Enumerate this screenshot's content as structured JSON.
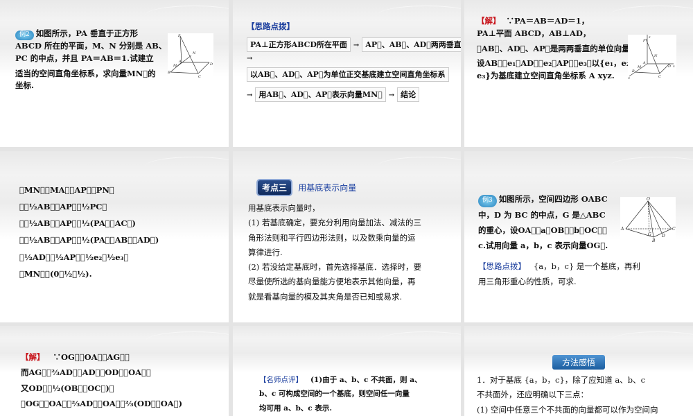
{
  "slides": [
    {
      "badge": "例2",
      "lines": [
        "如图所示，PA 垂直于正方形",
        "ABCD 所在的平面，M、N 分别是 AB、",
        "PC 的中点，并且 PA＝AB＝1.试建立",
        "适当的空间直角坐标系，求向量MN⃗的",
        "坐标."
      ],
      "figure_labels": [
        "P",
        "N",
        "A",
        "M",
        "B",
        "D",
        "C"
      ]
    },
    {
      "heading": "【思路点拨】",
      "box1": "PA⊥正方形ABCD所在平面",
      "box2": "AP⃗、AB⃗、AD⃗两两垂直",
      "box3": "以AB⃗、AD⃗、AP⃗为单位正交基底建立空间直角坐标系",
      "box4": "用AB⃗、AD⃗、AP⃗表示向量MN⃗",
      "box5": "结论",
      "arrow": "→"
    },
    {
      "label": "【解】",
      "lines": [
        "∵PA＝AB＝AD＝1，",
        "PA⊥平面 ABCD，AB⊥AD，",
        "∴AB⃗、AD⃗、AP⃗是两两垂直的单位向量.",
        "设AB⃗＝e₁，AD⃗＝e₂，AP⃗＝e₃，以{e₁，e₂，",
        "e₃}为基底建立空间直角坐标系 A xyz."
      ],
      "figure_labels": [
        "z",
        "P",
        "N",
        "A",
        "M",
        "B",
        "D",
        "x",
        "C",
        "y"
      ]
    },
    {
      "lines": [
        "∵MN⃗＝MA⃗＋AP⃗＋PN⃗",
        "＝－½AB⃗＋AP⃗＋½PC⃗",
        "＝－½AB⃗＋AP⃗＋½(PA⃗＋AC⃗)",
        "＝－½AB⃗＋AP⃗＋½(PA⃗＋AB⃗＋AD⃗)",
        "＝½AD⃗＋½AP⃗＝½e₂＋½e₃，",
        "∴MN⃗＝(0，½，½)."
      ]
    },
    {
      "tag": "考点三",
      "title": "用基底表示向量",
      "lines": [
        "用基底表示向量时，",
        "(1) 若基底确定，要充分利用向量加法、减法的三",
        "角形法则和平行四边形法则，以及数乘向量的运",
        "算律进行.",
        "(2) 若没给定基底时，首先选择基底．选择时，要",
        "尽量使所选的基向量能方便地表示其他向量，再",
        "就是看基向量的模及其夹角是否已知或易求."
      ]
    },
    {
      "badge": "例3",
      "lines": [
        "如图所示，空间四边形 OABC",
        "中，D 为 BC 的中点，G 是△ABC",
        "的重心，设OA⃗＝a，OB⃗＝b，OC⃗＝",
        "c.试用向量 a，b，c 表示向量OG⃗."
      ],
      "hint_label": "【思路点拨】",
      "hint_lines": [
        "{a，b，c} 是一个基底，再利",
        "用三角形重心的性质，可求."
      ],
      "figure_labels": [
        "O",
        "A",
        "C",
        "G",
        "D",
        "B"
      ]
    },
    {
      "label": "【解】",
      "lines": [
        "∵OG⃗＝OA⃗＋AG⃗，",
        "而AG⃗＝⅔AD⃗，AD⃗＝OD⃗－OA⃗，",
        "又OD⃗＝½(OB⃗＋OC⃗)，",
        "∴OG⃗＝OA⃗＋⅔AD⃗＝OA⃗＋⅔(OD⃗－OA⃗)"
      ]
    },
    {
      "label": "【名师点评】",
      "lines": [
        "(1)由于 a、b、c 不共面，则 a、",
        "b、c 可构成空间的一个基底，则空间任一向量",
        "均可用 a、b、c 表示."
      ]
    },
    {
      "title": "方法感悟",
      "lines": [
        "1．对于基底 {a，b，c}，除了应知道 a、b、c",
        "不共面外，还应明确以下三点：",
        "(1) 空间中任意三个不共面的向量都可以作为空间向"
      ]
    }
  ]
}
